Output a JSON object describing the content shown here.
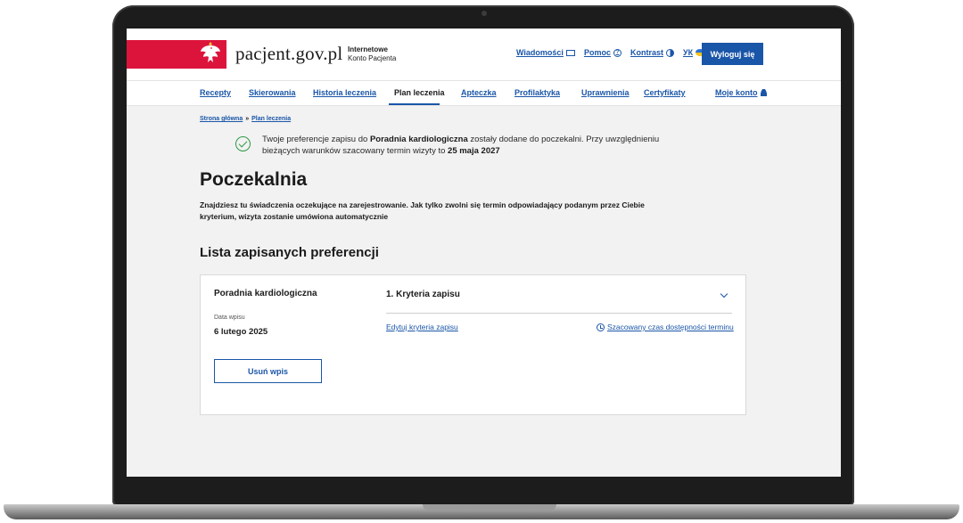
{
  "site": {
    "brand": "pacjent.gov.pl",
    "brand_sub_line1": "Internetowe",
    "brand_sub_line2": "Konto Pacjenta",
    "accent_color": "#1a56a8",
    "brand_red": "#dc143c"
  },
  "header": {
    "links": [
      {
        "label": "Wiadomości",
        "icon": "envelope-icon"
      },
      {
        "label": "Pomoc",
        "icon": "help-circle-icon"
      },
      {
        "label": "Kontrast",
        "icon": "contrast-icon"
      },
      {
        "label": "УК",
        "icon": "ukraine-flag-icon"
      }
    ],
    "logout_label": "Wyloguj się"
  },
  "nav": {
    "items": [
      "Recepty",
      "Skierowania",
      "Historia leczenia",
      "Plan leczenia",
      "Apteczka",
      "Profilaktyka",
      "Uprawnienia",
      "Certyfikaty"
    ],
    "active": "Plan leczenia",
    "account_label": "Moje konto"
  },
  "breadcrumb": {
    "home": "Strona główna",
    "separator": "»",
    "current": "Plan leczenia"
  },
  "notice": {
    "text_before": "Twoje preferencje zapisu do ",
    "clinic": "Poradnia kardiologiczna",
    "text_middle": " zostały dodane do poczekalni. Przy uwzględnieniu bieżących warunków szacowany termin wizyty to ",
    "date": "25 maja 2027"
  },
  "page": {
    "title": "Poczekalnia",
    "lead": "Znajdziesz tu świadczenia oczekujące na zarejestrowanie. Jak tylko zwolni się termin odpowiadający podanym przez Ciebie kryterium, wizyta zostanie umówiona automatycznie",
    "list_title": "Lista zapisanych preferencji"
  },
  "card": {
    "clinic": "Poradnia kardiologiczna",
    "date_label": "Data wpisu",
    "date_value": "6 lutego 2025",
    "remove_label": "Usuń wpis",
    "accordion_title": "1. Kryteria zapisu",
    "edit_label": "Edytuj kryteria zapisu",
    "estimate_label": "Szacowany czas dostępności terminu"
  }
}
